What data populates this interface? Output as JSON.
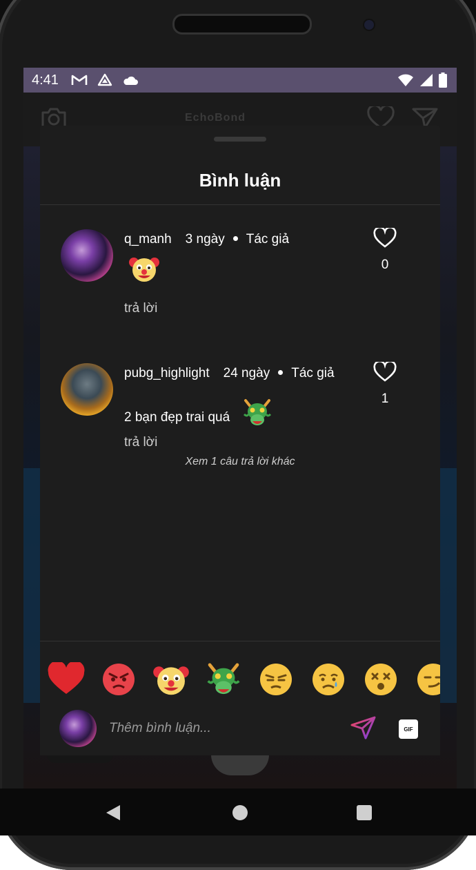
{
  "status_bar": {
    "time": "4:41",
    "left_icons": [
      "gmail-icon",
      "drive-icon",
      "cloud-icon"
    ],
    "right_icons": [
      "wifi-icon",
      "signal-icon",
      "battery-icon"
    ]
  },
  "app_bar": {
    "title": "EchoBond",
    "icons": [
      "camera-icon",
      "heart-icon",
      "send-icon"
    ]
  },
  "comments_sheet": {
    "title": "Bình luận",
    "comments": [
      {
        "username": "q_manh",
        "time": "3 ngày",
        "role": "Tác giả",
        "text": "",
        "emoji": "clown-emoji",
        "reply_label": "trả lời",
        "likes": "0"
      },
      {
        "username": "pubg_highlight",
        "time": "24 ngày",
        "role": "Tác giả",
        "text": "2 bạn đẹp trai quá",
        "emoji": "dragon-emoji",
        "reply_label": "trả lời",
        "likes": "1"
      }
    ],
    "more_replies": "Xem 1 câu trả lời khác",
    "emoji_bar": [
      "heart-emoji",
      "angry-emoji",
      "clown-emoji",
      "dragon-emoji",
      "annoyed-emoji",
      "sad-emoji",
      "dizzy-emoji",
      "smirk-emoji"
    ],
    "input": {
      "placeholder": "Thêm bình luận...",
      "gif_label": "GIF"
    }
  },
  "colors": {
    "status_bar": "#5a506e",
    "sheet_bg": "#1d1d1d",
    "heart_red": "#e0282e",
    "send_gradient_start": "#f2465a",
    "send_gradient_end": "#7b3fe4"
  }
}
